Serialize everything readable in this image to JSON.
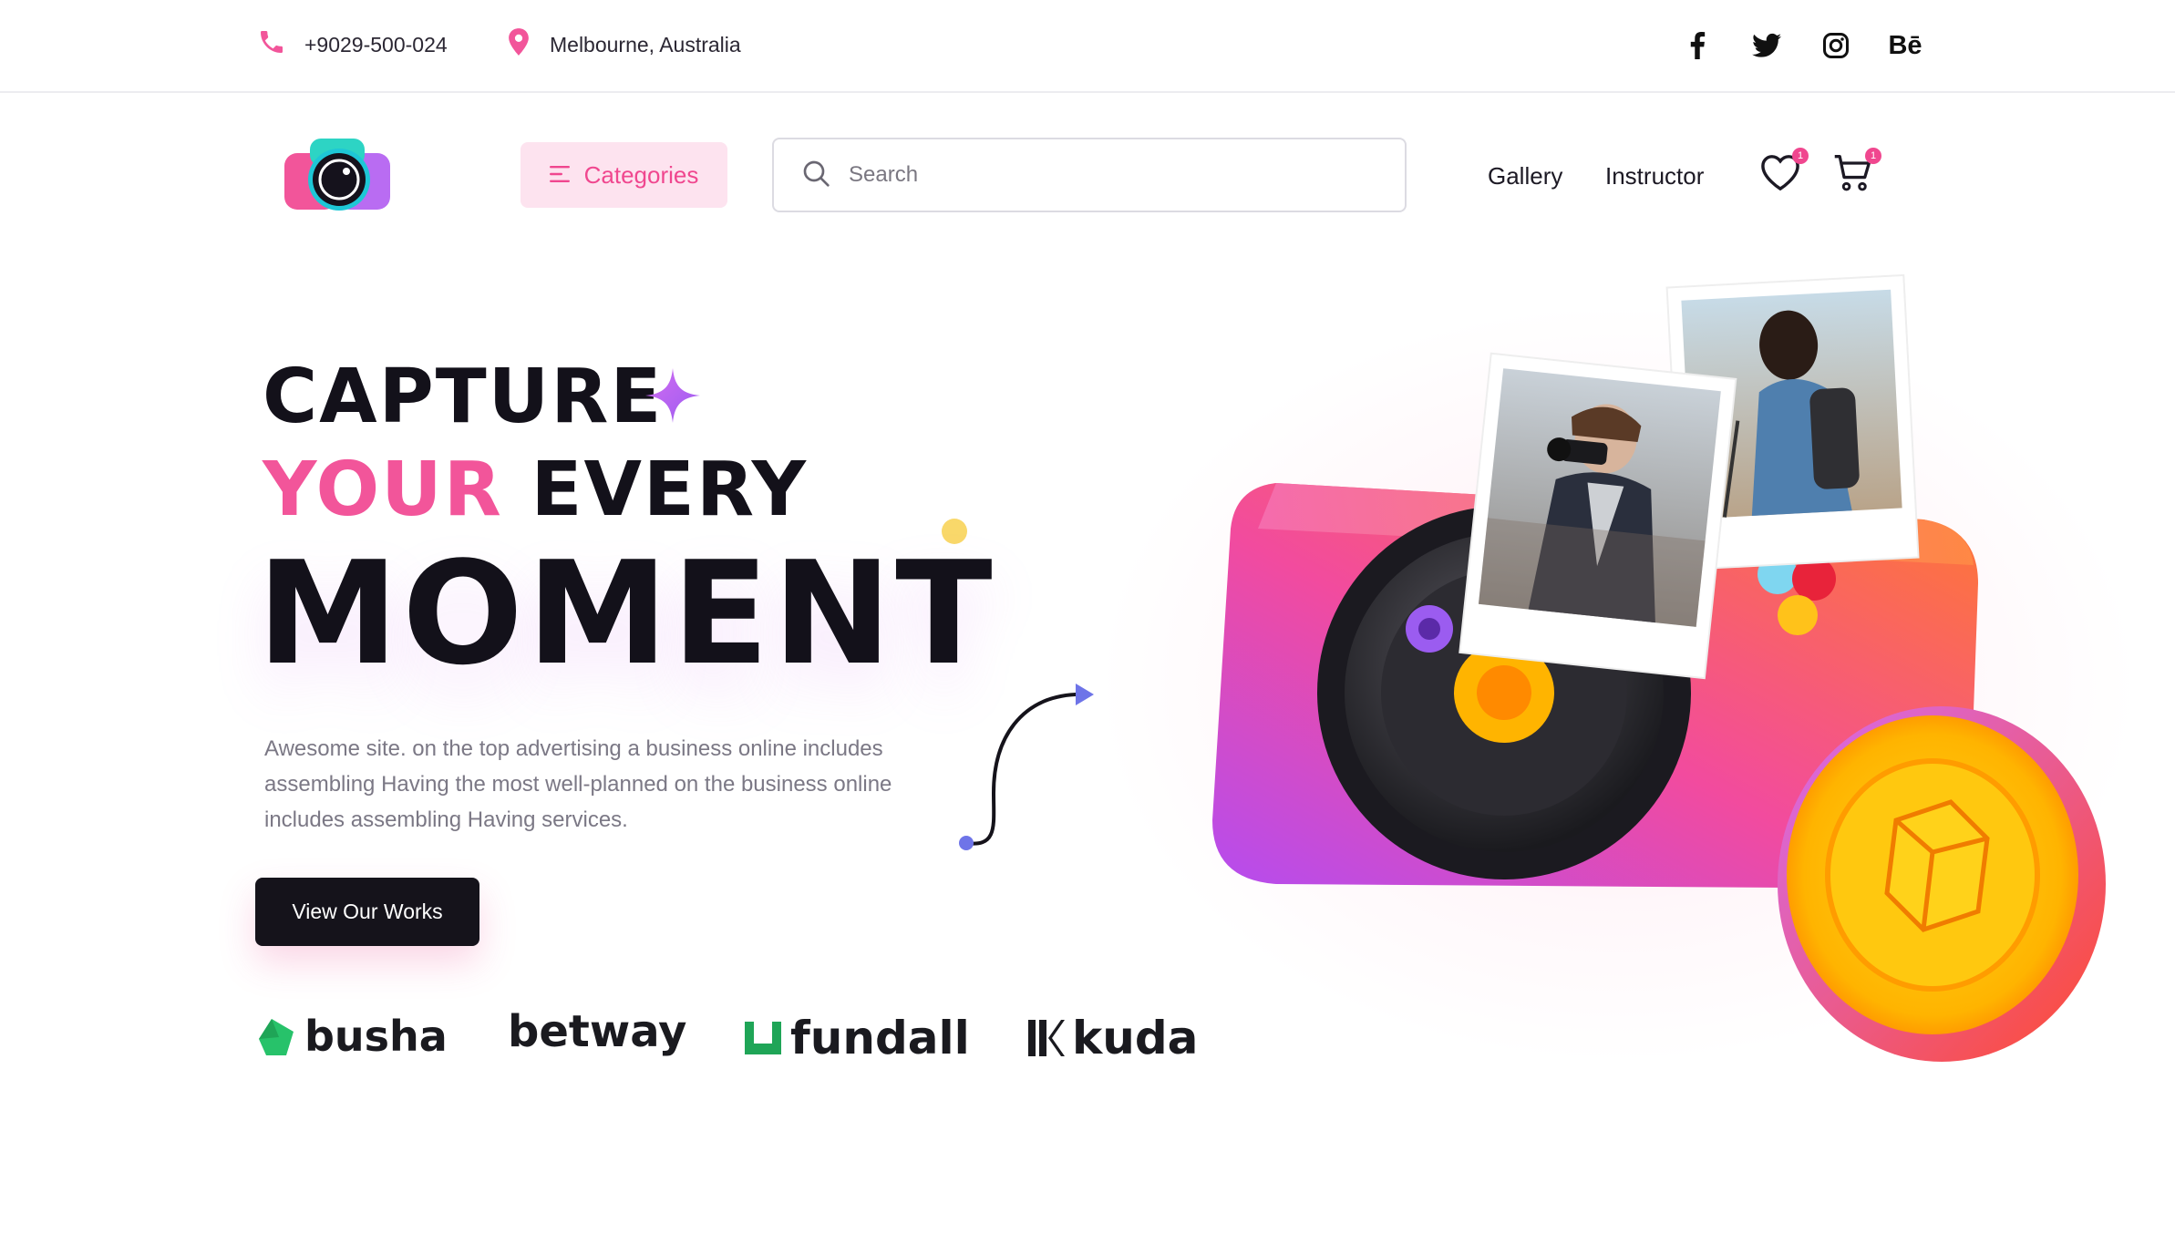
{
  "topbar": {
    "phone": "+9029-500-024",
    "location": "Melbourne, Australia",
    "socials": [
      {
        "name": "facebook-icon",
        "label": "f"
      },
      {
        "name": "twitter-icon",
        "label": ""
      },
      {
        "name": "instagram-icon",
        "label": ""
      },
      {
        "name": "behance-icon",
        "label": "Bē"
      }
    ]
  },
  "header": {
    "categories_label": "Categories",
    "search_placeholder": "Search",
    "nav": [
      "Gallery",
      "Instructor"
    ],
    "wishlist_count": "1",
    "cart_count": "1"
  },
  "hero": {
    "line1": "CAPTURE",
    "line2_pink": "YOUR",
    "line2_dark": "EVERY",
    "line3": "MOMENT",
    "description": "Awesome  site. on the top advertising a business online includes assembling Having the most well-planned on the business online includes assembling Having services.",
    "cta_label": "View Our Works"
  },
  "brands": [
    "busha",
    "betway",
    "fundall",
    "kuda"
  ],
  "colors": {
    "accent_pink": "#f2559a",
    "dark": "#13111a",
    "categories_bg": "#fde3ef",
    "sparkle": "#b46cf0"
  }
}
